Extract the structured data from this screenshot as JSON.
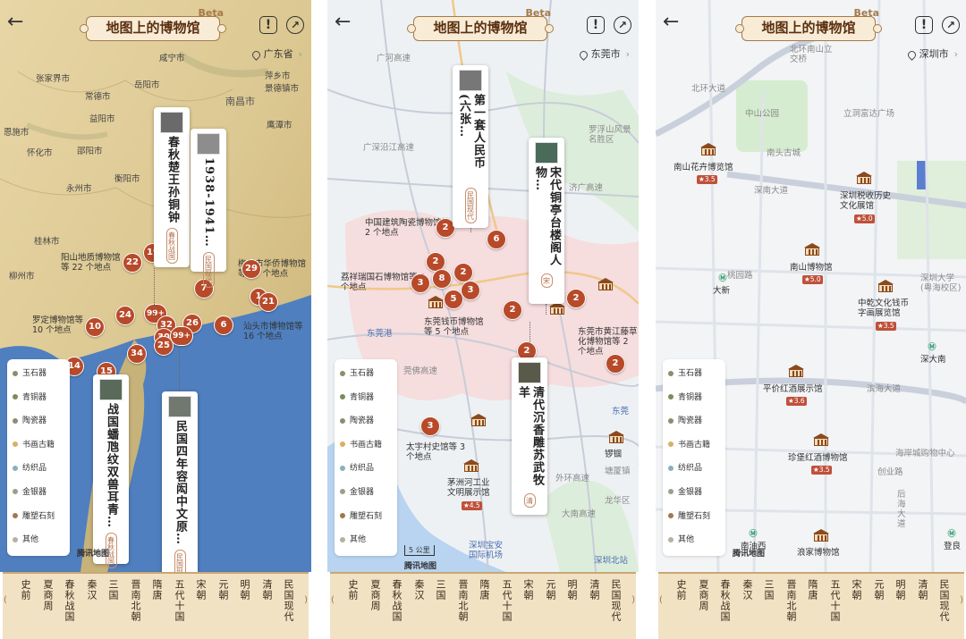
{
  "common": {
    "title": "地图上的博物馆",
    "beta": "Beta",
    "back_icon": "back-arrow-icon",
    "legend": [
      {
        "label": "玉石器",
        "color": "#8a8f6a"
      },
      {
        "label": "青铜器",
        "color": "#7a8c5a"
      },
      {
        "label": "陶瓷器",
        "color": "#8e8c70"
      },
      {
        "label": "书画古籍",
        "color": "#d8b060"
      },
      {
        "label": "纺织品",
        "color": "#8ab0c0"
      },
      {
        "label": "金银器",
        "color": "#9aa08a"
      },
      {
        "label": "雕塑石刻",
        "color": "#a07850"
      },
      {
        "label": "其他",
        "color": "#b8b0a0"
      }
    ],
    "dynasties": [
      "史前",
      "夏商周",
      "春秋战国",
      "秦汉",
      "三国",
      "晋南北朝",
      "隋唐",
      "五代十国",
      "宋朝",
      "元朝",
      "明朝",
      "清朝",
      "民国现代"
    ],
    "left_arrow": "(",
    "right_arrow": ")"
  },
  "panel1": {
    "location": "广东省",
    "brand": "腾讯地图",
    "cities": [
      "咸宁市",
      "张家界市",
      "岳阳市",
      "常德市",
      "萍乡市",
      "南昌市",
      "景德镇市",
      "益阳市",
      "鹰潭市",
      "怀化市",
      "邵阳市",
      "衡阳市",
      "永州市",
      "桂林市",
      "柳州市",
      "恩施市"
    ],
    "cards": [
      {
        "title": "春秋楚王孙铜钟",
        "tag": "春秋战国"
      },
      {
        "title": "1938-1941…",
        "tag": "民国现代"
      },
      {
        "title": "战国蟠虺纹双兽耳青…",
        "tag": "春秋战国"
      },
      {
        "title": "民国四年容闳中文原…",
        "tag": "民国现代"
      }
    ],
    "clusters": [
      "19",
      "22",
      "29",
      "7",
      "24",
      "99+",
      "32",
      "26",
      "30",
      "99+",
      "25",
      "10",
      "6",
      "34",
      "14",
      "15",
      "1",
      "21"
    ],
    "labels": [
      "阳山地质博物馆等 22 个地点",
      "梅州市华侨博物馆等 29 个地点",
      "罗定博物馆等 10 个地点",
      "汕头市博物馆等 16 个地点"
    ]
  },
  "panel2": {
    "location": "东莞市",
    "scale": "5 公里",
    "brand": "腾讯地图",
    "roads": [
      "广河高速",
      "罗浮山风景名胜区",
      "济广高速",
      "广深沿江高速",
      "东莞港",
      "莞佛高速",
      "龙华区",
      "深圳宝安国际机场",
      "深圳北站",
      "东莞",
      "外环高速",
      "大南高速",
      "塘厦镇"
    ],
    "cards": [
      {
        "title": "第一套人民币(六张…",
        "tag": "民国现代"
      },
      {
        "title": "宋代铜亭台楼阁人物…",
        "tag": "宋"
      },
      {
        "title": "清代沉香雕苏武牧羊",
        "tag": "清"
      }
    ],
    "clusters": [
      "2",
      "6",
      "2",
      "2",
      "3",
      "8",
      "5",
      "3",
      "2",
      "2",
      "2",
      "2",
      "3"
    ],
    "labels": [
      "中国建筑陶瓷博物馆等 2 个地点",
      "荔祥瑞国石博物馆等 3 个地点",
      "东莞钱币博物馆等 5 个地点",
      "东莞市黄江藤草化博物馆等 2 个地点",
      "太宇村史馆等 3 个地点",
      "茅洲河工业文明展示馆",
      "锣锢"
    ],
    "rating": "4.5"
  },
  "panel3": {
    "location": "深圳市",
    "brand": "腾讯地图",
    "streets": [
      "北环大道",
      "中山公园",
      "北环南山立交桥",
      "立洞富达广场",
      "南头古城",
      "深南大道",
      "桃园路",
      "深圳大学(粤海校区)",
      "滨海大道",
      "海岸城购物中心",
      "创业路",
      "后海大道",
      "登良",
      "深大南",
      "大新"
    ],
    "museums": [
      {
        "name": "南山花卉博览馆",
        "rating": "3.5"
      },
      {
        "name": "深圳税收历史文化展馆",
        "rating": "5.0"
      },
      {
        "name": "南山博物馆",
        "rating": "5.0"
      },
      {
        "name": "中乾文化钱币字画展览馆",
        "rating": "3.5"
      },
      {
        "name": "平价红酒展示馆",
        "rating": "3.6"
      },
      {
        "name": "珍堡红酒博物馆",
        "rating": "3.5"
      },
      {
        "name": "浪家博物馆",
        "rating": ""
      }
    ],
    "metros": [
      "南油西"
    ]
  }
}
